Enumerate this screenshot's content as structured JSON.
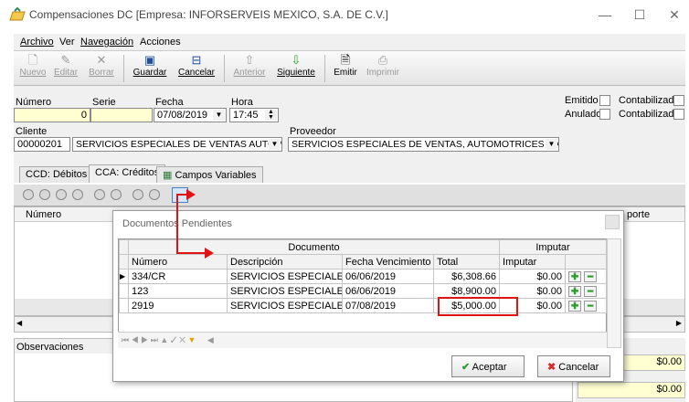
{
  "window": {
    "title": "Compensaciones DC [Empresa: INFORSERVEIS MEXICO, S.A. DE C.V.]",
    "minimize": "—",
    "maximize": "☐",
    "close": "✕"
  },
  "menu": [
    "Archivo",
    "Ver",
    "Navegación",
    "Acciones"
  ],
  "toolbar": [
    {
      "label": "Nuevo",
      "icon": "new-document-icon",
      "enabled": false
    },
    {
      "label": "Editar",
      "icon": "edit-icon",
      "enabled": false
    },
    {
      "label": "Borrar",
      "icon": "delete-icon",
      "enabled": false
    },
    {
      "label": "Guardar",
      "icon": "save-icon",
      "enabled": true
    },
    {
      "label": "Cancelar",
      "icon": "cancel-icon",
      "enabled": true
    },
    {
      "label": "Anterior",
      "icon": "arrow-up-icon",
      "enabled": false
    },
    {
      "label": "Siguiente",
      "icon": "arrow-down-icon",
      "enabled": true
    },
    {
      "label": "Emitir",
      "icon": "document-icon",
      "enabled": true
    },
    {
      "label": "Imprimir",
      "icon": "printer-icon",
      "enabled": false
    }
  ],
  "form": {
    "numero_label": "Número",
    "numero_value": "0",
    "serie_label": "Serie",
    "serie_value": "",
    "fecha_label": "Fecha",
    "fecha_value": "07/08/2019",
    "hora_label": "Hora",
    "hora_value": "17:45",
    "cliente_label": "Cliente",
    "cliente_code": "00000201",
    "cliente_name": "SERVICIOS ESPECIALES DE VENTAS AUTOM",
    "proveedor_label": "Proveedor",
    "proveedor_name": "SERVICIOS ESPECIALES DE VENTAS, AUTOMOTRICES S.A",
    "emitido_label": "Emitido",
    "anulado_label": "Anulado",
    "contabilizado1_label": "Contabilizado",
    "contabilizado2_label": "Contabilizado"
  },
  "tabs": [
    "CCD: Débitos",
    "CCA: Créditos",
    "Campos Variables"
  ],
  "main_grid": {
    "numero_header": "Número",
    "importe_header": "porte"
  },
  "observaciones_label": "Observaciones",
  "totals": [
    "$0.00",
    "$0.00"
  ],
  "dialog": {
    "title": "Documentos Pendientes",
    "group_documento": "Documento",
    "group_imputar": "Imputar",
    "columns": [
      "Número",
      "Descripción",
      "Fecha Vencimiento",
      "Total",
      "Imputar"
    ],
    "rows": [
      {
        "numero": "334/CR",
        "descripcion": "SERVICIOS ESPECIALES ...",
        "fecha": "06/06/2019",
        "total": "$6,308.66",
        "imputar": "$0.00",
        "current": true
      },
      {
        "numero": "123",
        "descripcion": "SERVICIOS ESPECIALES ...",
        "fecha": "06/06/2019",
        "total": "$8,900.00",
        "imputar": "$0.00",
        "current": false
      },
      {
        "numero": "2919",
        "descripcion": "SERVICIOS ESPECIALES ...",
        "fecha": "07/08/2019",
        "total": "$5,000.00",
        "imputar": "$0.00",
        "current": false
      }
    ],
    "accept_label": "Aceptar",
    "cancel_label": "Cancelar"
  }
}
